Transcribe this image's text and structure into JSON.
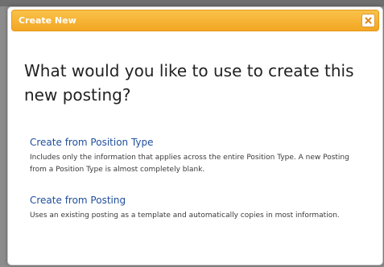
{
  "dialog": {
    "title": "Create New",
    "close_label": "close",
    "heading": "What would you like to use to create this new posting?",
    "options": [
      {
        "label": "Create from Position Type",
        "description": "Includes only the information that applies across the entire Position Type. A new Posting from a Position Type is almost completely blank."
      },
      {
        "label": "Create from Posting",
        "description": "Uses an existing posting as a template and automatically copies in most information."
      }
    ]
  },
  "colors": {
    "titlebar": "#f3a623",
    "link": "#1f4e9c",
    "overlay": "#8c8c8c"
  }
}
